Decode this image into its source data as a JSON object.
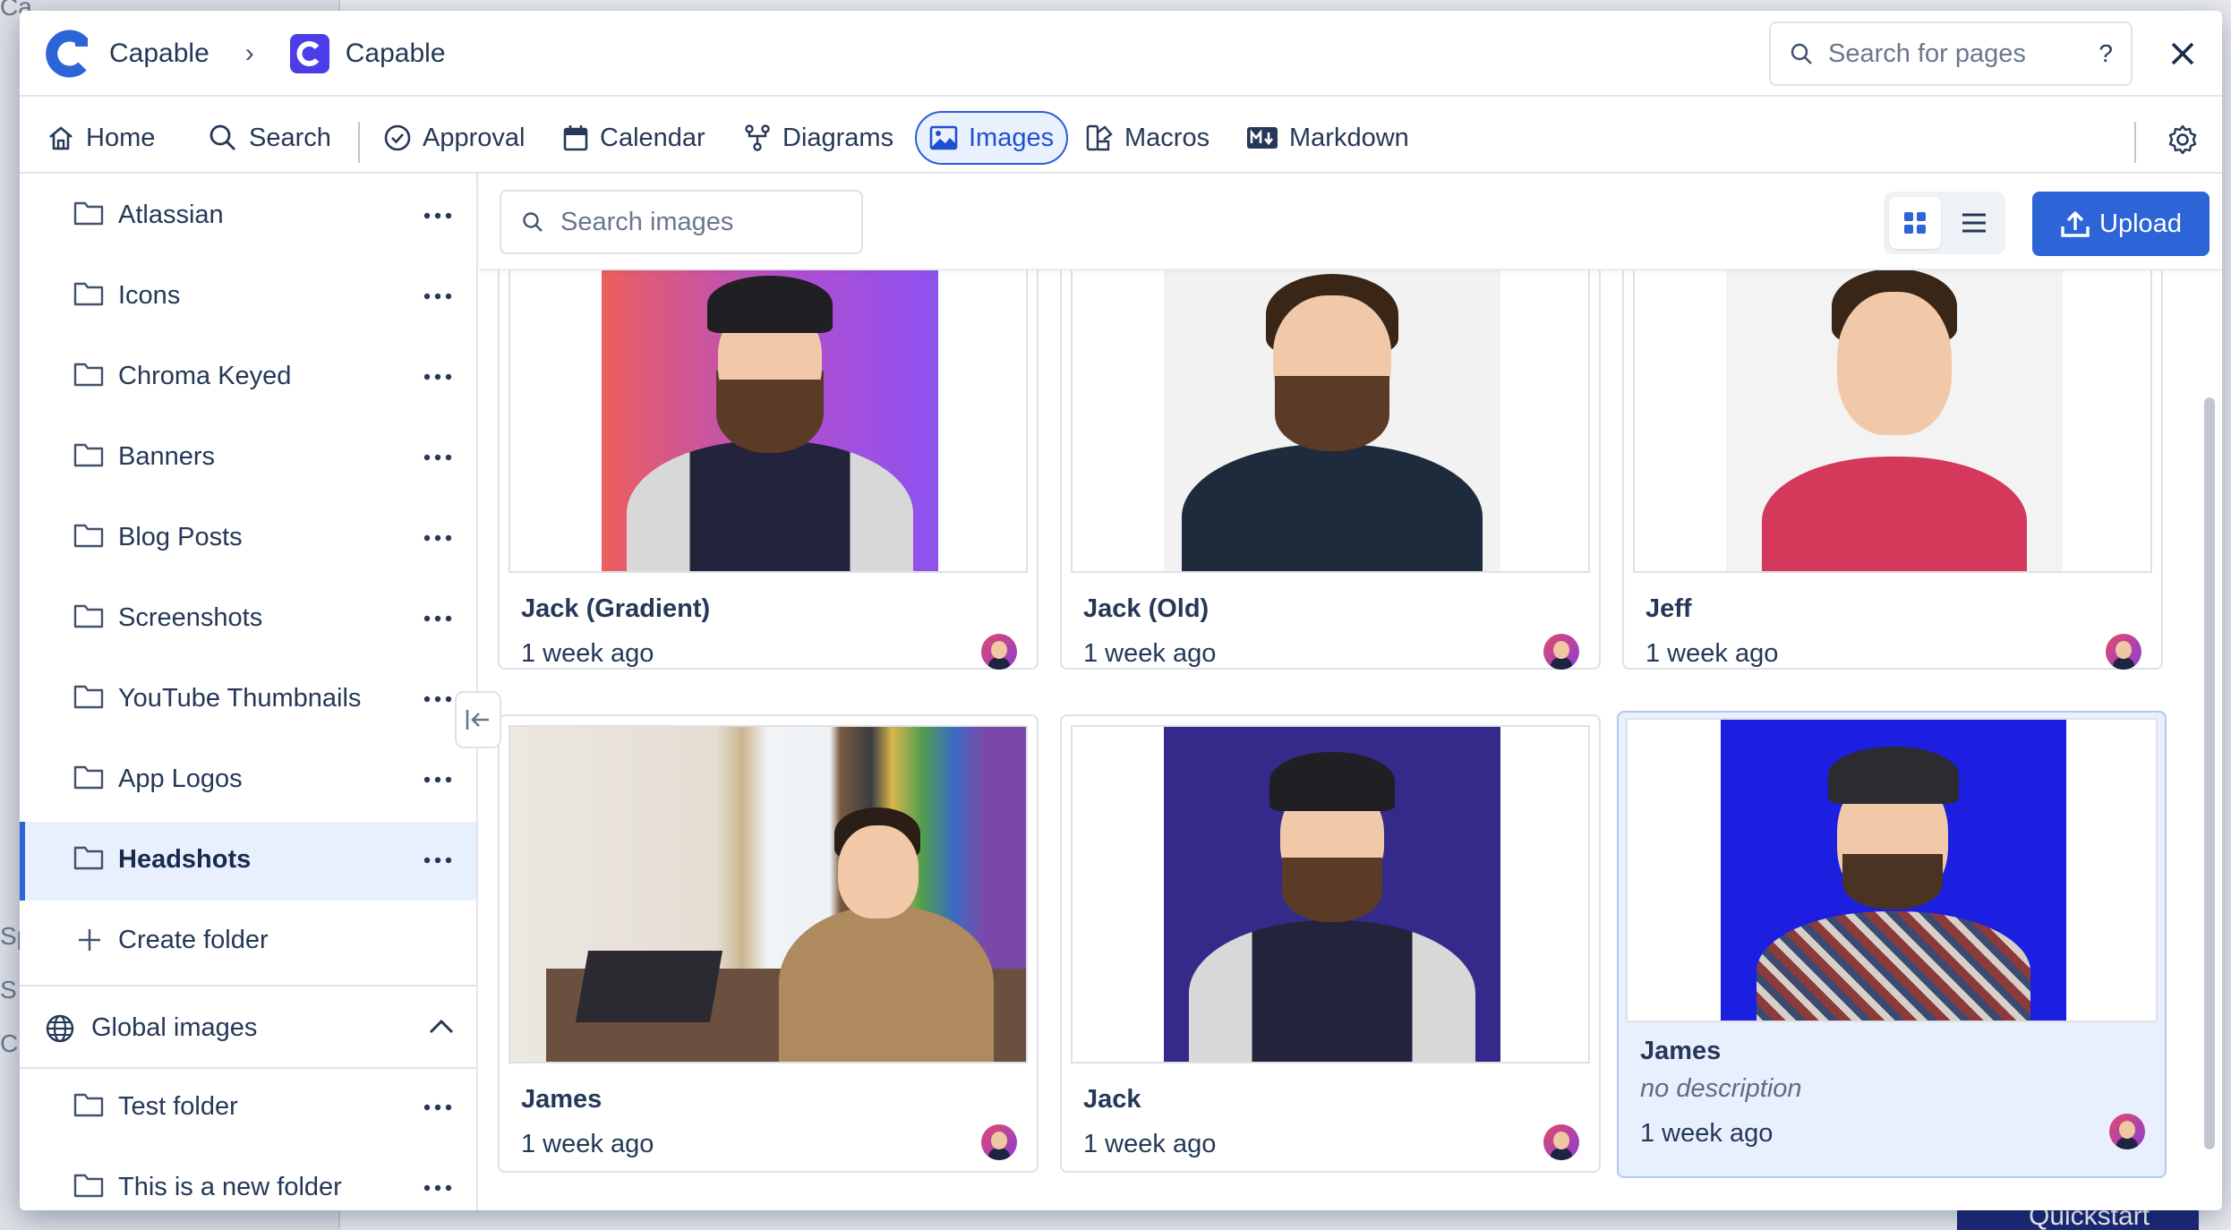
{
  "background": {
    "fragments": [
      "Ca",
      "Sp",
      "S",
      "C"
    ],
    "quickstart_label": "Quickstart"
  },
  "header": {
    "breadcrumb": [
      {
        "label": "Capable"
      },
      {
        "label": "Capable"
      }
    ],
    "search_placeholder": "Search for pages",
    "help_label": "?"
  },
  "nav": {
    "items": [
      {
        "label": "Home",
        "icon": "home-icon"
      },
      {
        "label": "Search",
        "icon": "search-icon"
      },
      {
        "label": "Approval",
        "icon": "check-circle-icon"
      },
      {
        "label": "Calendar",
        "icon": "calendar-icon"
      },
      {
        "label": "Diagrams",
        "icon": "diagram-icon"
      },
      {
        "label": "Images",
        "icon": "image-icon",
        "active": true
      },
      {
        "label": "Macros",
        "icon": "macros-icon"
      },
      {
        "label": "Markdown",
        "icon": "markdown-icon"
      }
    ]
  },
  "sidebar": {
    "folders": [
      {
        "label": "Atlassian"
      },
      {
        "label": "Icons"
      },
      {
        "label": "Chroma Keyed"
      },
      {
        "label": "Banners"
      },
      {
        "label": "Blog Posts"
      },
      {
        "label": "Screenshots"
      },
      {
        "label": "YouTube Thumbnails"
      },
      {
        "label": "App Logos"
      },
      {
        "label": "Headshots",
        "active": true
      }
    ],
    "create_folder_label": "Create folder",
    "global_section_label": "Global images",
    "global_folders": [
      {
        "label": "Test folder"
      },
      {
        "label": "This is a new folder"
      }
    ]
  },
  "toolbar": {
    "search_placeholder": "Search images",
    "upload_label": "Upload"
  },
  "images": [
    {
      "title": "Jack (Gradient)",
      "date": "1 week ago"
    },
    {
      "title": "Jack (Old)",
      "date": "1 week ago"
    },
    {
      "title": "Jeff",
      "date": "1 week ago"
    },
    {
      "title": "James",
      "date": "1 week ago"
    },
    {
      "title": "Jack",
      "date": "1 week ago"
    },
    {
      "title": "James",
      "description": "no description",
      "date": "1 week ago",
      "selected": true
    }
  ],
  "colors": {
    "accent": "#2d64d8",
    "selected_bg": "#e9f0fd",
    "text": "#253858"
  }
}
